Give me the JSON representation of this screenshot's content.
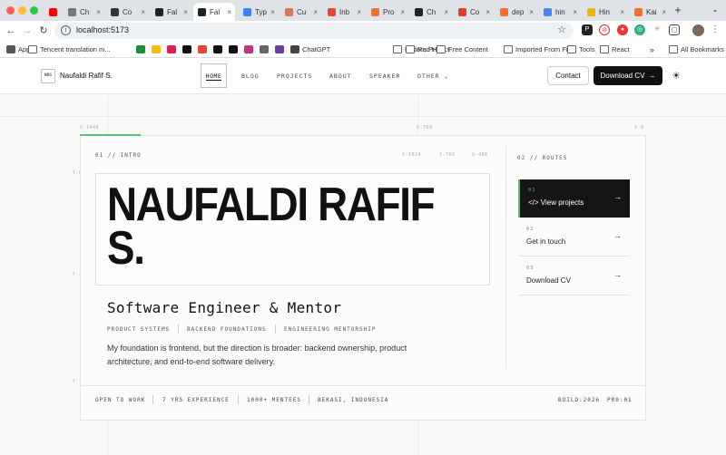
{
  "browser": {
    "tabs": [
      {
        "label": "",
        "icon": "youtube-icon",
        "color": "#ff0000"
      },
      {
        "label": "Ch",
        "icon": "globe-icon",
        "color": "#777777"
      },
      {
        "label": "Co",
        "icon": "zd-icon",
        "color": "#333333"
      },
      {
        "label": "Fal",
        "icon": "site-icon",
        "color": "#222222"
      },
      {
        "label": "Fal",
        "icon": "site-icon",
        "color": "#222222",
        "active": true
      },
      {
        "label": "Typ",
        "icon": "typing-icon",
        "color": "#3b82f6"
      },
      {
        "label": "Cu",
        "icon": "claude-icon",
        "color": "#d97757"
      },
      {
        "label": "Inb",
        "icon": "gmail-icon",
        "color": "#ea4335"
      },
      {
        "label": "Pro",
        "icon": "gitlab-icon",
        "color": "#fc6d26"
      },
      {
        "label": "Ch",
        "icon": "site-icon",
        "color": "#222222"
      },
      {
        "label": "Co",
        "icon": "red-circle-icon",
        "color": "#e33e2b"
      },
      {
        "label": "dep",
        "icon": "gitlab-icon",
        "color": "#fc6d26"
      },
      {
        "label": "hin",
        "icon": "google-icon",
        "color": "#4285f4"
      },
      {
        "label": "Hin",
        "icon": "app-icon",
        "color": "#f4b400"
      },
      {
        "label": "Kai",
        "icon": "gitlab-icon",
        "color": "#fc6d26"
      }
    ],
    "url": "localhost:5173",
    "bookmarks": [
      {
        "label": "Apps",
        "icon": "apps-grid-icon"
      },
      {
        "label": "Tencent translation m...",
        "icon": "folder-icon"
      },
      {
        "label": "",
        "icon": "sheets-icon"
      },
      {
        "label": "",
        "icon": "drive-icon"
      },
      {
        "label": "",
        "icon": "slack-icon"
      },
      {
        "label": "",
        "icon": "github-icon"
      },
      {
        "label": "",
        "icon": "gmail-icon"
      },
      {
        "label": "",
        "icon": "x-icon"
      },
      {
        "label": "",
        "icon": "x-icon"
      },
      {
        "label": "",
        "icon": "instagram-icon"
      },
      {
        "label": "",
        "icon": "bracket-icon"
      },
      {
        "label": "",
        "icon": "purple-icon"
      },
      {
        "label": "ChatGPT",
        "icon": "chatgpt-icon"
      },
      {
        "label": "Fedora Project",
        "icon": "folder-icon"
      },
      {
        "label": "Red Hat",
        "icon": "folder-icon"
      },
      {
        "label": "Free Content",
        "icon": "folder-icon"
      },
      {
        "label": "Imported From Fir...",
        "icon": "folder-icon"
      },
      {
        "label": "Tools",
        "icon": "folder-icon"
      },
      {
        "label": "React",
        "icon": "folder-icon"
      }
    ],
    "more_bookmarks": "»",
    "all_bookmarks": "All Bookmarks"
  },
  "site": {
    "logo_mark": "NRS",
    "logo_name": "Naufaldi Rafif S.",
    "nav": [
      {
        "label": "HOME",
        "active": true
      },
      {
        "label": "BLOG"
      },
      {
        "label": "PROJECTS"
      },
      {
        "label": "ABOUT"
      },
      {
        "label": "SPEAKER"
      },
      {
        "label": "OTHER ⌄"
      }
    ],
    "contact_label": "Contact",
    "cv_label": "Download CV",
    "cv_arrow": "→",
    "theme_icon": "☀"
  },
  "grid": {
    "x_labels": [
      "X-1440",
      "X-768",
      "X-0"
    ],
    "y_labels": [
      "Y-0",
      "Y-360",
      "Y-720"
    ],
    "breakpoints": [
      "X-1024",
      "X-768",
      "X-480"
    ]
  },
  "intro": {
    "section_label": "01 // INTRO",
    "name": "NAUFALDI RAFIF S.",
    "role": "Software Engineer & Mentor",
    "tags": [
      "PRODUCT SYSTEMS",
      "BACKEND FOUNDATIONS",
      "ENGINEERING MENTORSHIP"
    ],
    "description": "My foundation is frontend, but the direction is broader: backend ownership, product architecture, and end-to-end software delivery."
  },
  "routes": {
    "section_label": "02 // ROUTES",
    "items": [
      {
        "num": "01",
        "label": "</> View projects",
        "active": true
      },
      {
        "num": "02",
        "label": "Get in touch"
      },
      {
        "num": "03",
        "label": "Download CV"
      }
    ],
    "arrow": "→"
  },
  "stats": {
    "items": [
      "OPEN TO WORK",
      "7 YRS EXPERIENCE",
      "1000+ MENTEES",
      "BEKASI, INDONESIA"
    ],
    "build": "BUILD:2026",
    "pr": "PR0:01"
  }
}
